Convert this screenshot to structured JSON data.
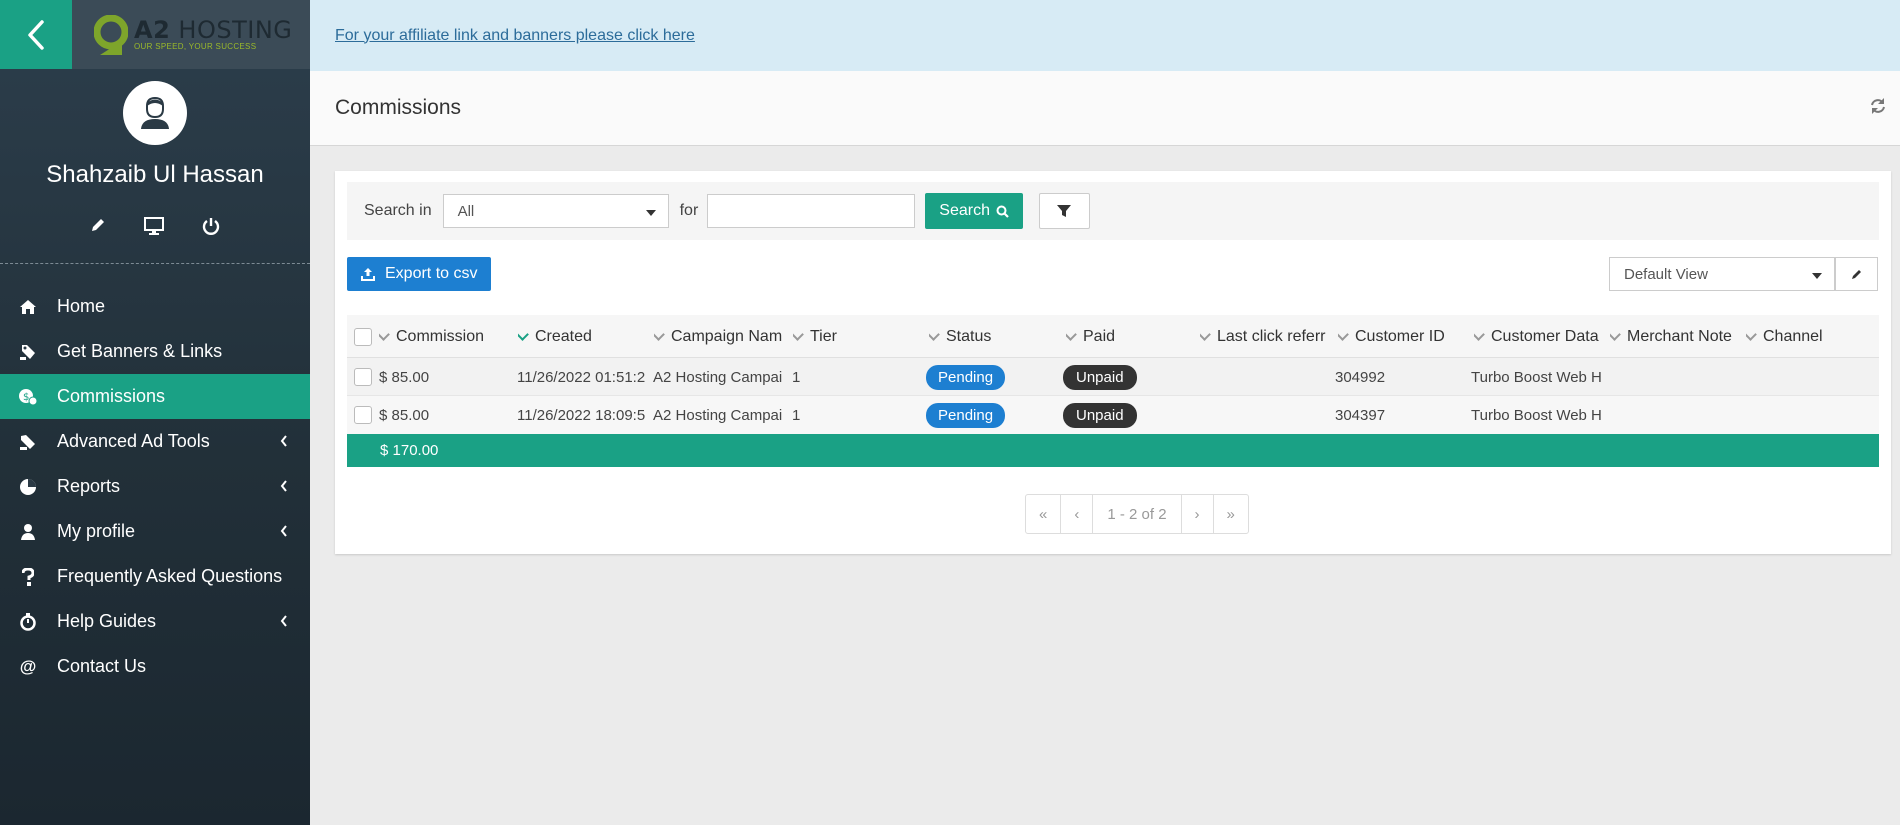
{
  "brand": {
    "name_bold": "A2",
    "name_rest": " HOSTING",
    "tagline": "OUR SPEED, YOUR SUCCESS",
    "accent": "#1aa185"
  },
  "user": {
    "name": "Shahzaib Ul Hassan"
  },
  "sidebar": {
    "items": [
      {
        "label": "Home",
        "icon": "home-icon",
        "has_submenu": false
      },
      {
        "label": "Get Banners & Links",
        "icon": "banner-icon",
        "has_submenu": false
      },
      {
        "label": "Commissions",
        "icon": "commissions-icon",
        "has_submenu": false,
        "active": true
      },
      {
        "label": "Advanced Ad Tools",
        "icon": "tools-icon",
        "has_submenu": true
      },
      {
        "label": "Reports",
        "icon": "pie-chart-icon",
        "has_submenu": true
      },
      {
        "label": "My profile",
        "icon": "user-icon",
        "has_submenu": true
      },
      {
        "label": "Frequently Asked Questions",
        "icon": "question-icon",
        "has_submenu": false
      },
      {
        "label": "Help Guides",
        "icon": "stopwatch-icon",
        "has_submenu": true
      },
      {
        "label": "Contact Us",
        "icon": "at-icon",
        "has_submenu": false
      }
    ]
  },
  "banner": {
    "link_text": "For your affiliate link and banners please click here"
  },
  "page": {
    "title": "Commissions"
  },
  "search": {
    "label_in": "Search in",
    "scope": "All",
    "label_for": "for",
    "query": "",
    "button": "Search"
  },
  "toolbar": {
    "export_label": "Export to csv",
    "view": "Default View"
  },
  "table": {
    "columns": [
      "Commission",
      "Created",
      "Campaign Nam",
      "Tier",
      "Status",
      "Paid",
      "Last click referr",
      "Customer ID",
      "Customer Data",
      "Merchant Note",
      "Channel"
    ],
    "rows": [
      {
        "commission": "$ 85.00",
        "created": "11/26/2022 01:51:2",
        "campaign": "A2 Hosting Campai",
        "tier": "1",
        "status": "Pending",
        "paid": "Unpaid",
        "last_click": "",
        "customer_id": "304992",
        "customer_data": "Turbo Boost Web H",
        "merchant_note": "",
        "channel": ""
      },
      {
        "commission": "$ 85.00",
        "created": "11/26/2022 18:09:5",
        "campaign": "A2 Hosting Campai",
        "tier": "1",
        "status": "Pending",
        "paid": "Unpaid",
        "last_click": "",
        "customer_id": "304397",
        "customer_data": "Turbo Boost Web H",
        "merchant_note": "",
        "channel": ""
      }
    ],
    "total": "$ 170.00"
  },
  "pager": {
    "first": "«",
    "prev": "‹",
    "info": "1 - 2 of 2",
    "next": "›",
    "last": "»"
  }
}
